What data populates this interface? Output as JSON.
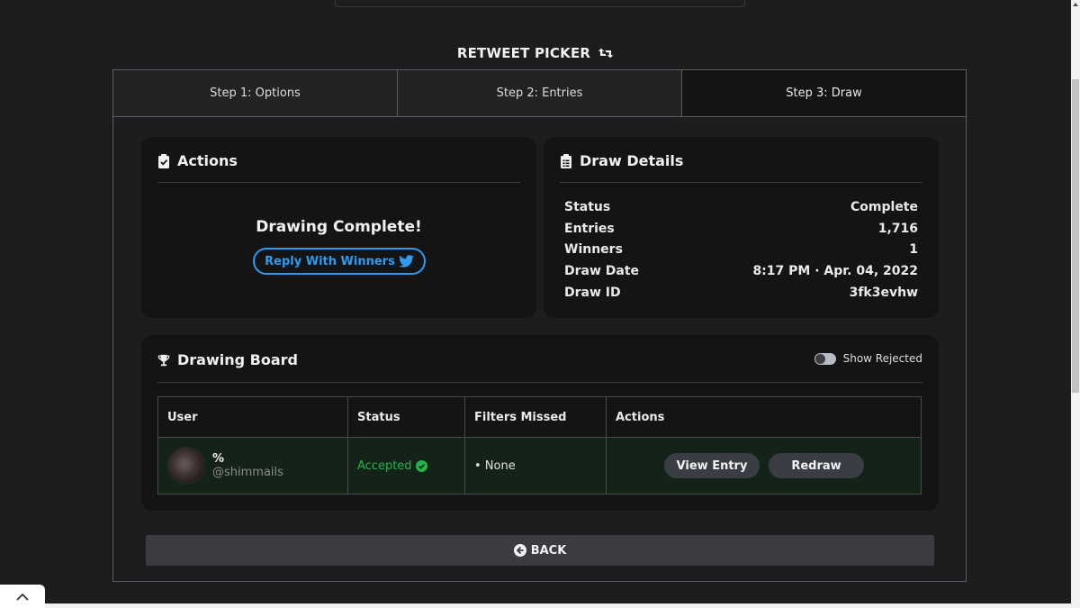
{
  "header": {
    "title": "RETWEET PICKER",
    "title_icon": "retweet-icon"
  },
  "tabs": [
    {
      "label": "Step 1: Options",
      "active": false
    },
    {
      "label": "Step 2: Entries",
      "active": false
    },
    {
      "label": "Step 3: Draw",
      "active": true
    }
  ],
  "actions_card": {
    "title": "Actions",
    "icon": "clipboard-check-icon",
    "message": "Drawing Complete!",
    "reply_button": "Reply With Winners",
    "reply_icon": "twitter-icon"
  },
  "details_card": {
    "title": "Draw Details",
    "icon": "clipboard-list-icon",
    "rows": [
      {
        "label": "Status",
        "value": "Complete"
      },
      {
        "label": "Entries",
        "value": "1,716"
      },
      {
        "label": "Winners",
        "value": "1"
      },
      {
        "label": "Draw Date",
        "value": "8:17 PM · Apr. 04, 2022"
      },
      {
        "label": "Draw ID",
        "value": "3fk3evhw"
      }
    ]
  },
  "board": {
    "title": "Drawing Board",
    "icon": "trophy-icon",
    "toggle_label": "Show Rejected",
    "toggle_on": false,
    "columns": [
      "User",
      "Status",
      "Filters Missed",
      "Actions"
    ],
    "rows": [
      {
        "name": "%",
        "handle": "@shimmails",
        "status": "Accepted",
        "filters_missed": "• None",
        "view_label": "View Entry",
        "redraw_label": "Redraw"
      }
    ]
  },
  "back_button": "BACK",
  "colors": {
    "background": "#1c1d1f",
    "card": "#141415",
    "accent_blue": "#2f9bf0",
    "accepted_green": "#28b34c",
    "row_bg": "#132317"
  }
}
